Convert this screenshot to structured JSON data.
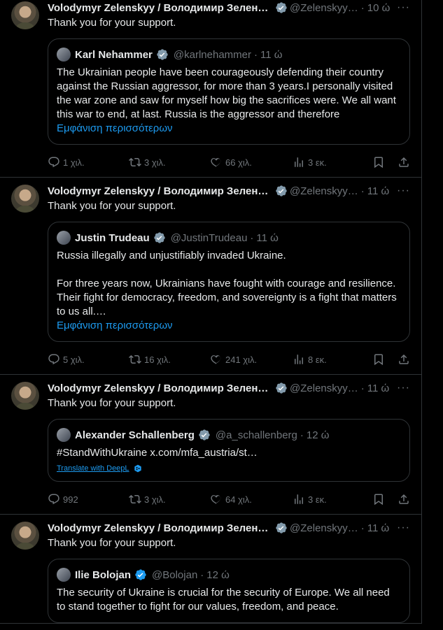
{
  "tweets": [
    {
      "author": "Volodymyr Zelenskyy / Володимир Зеленс…",
      "handle": "@Zelenskyy…",
      "time": "10 ώ",
      "text": "Thank you for your support.",
      "quote": {
        "name": "Karl Nehammer",
        "handle": "@karlnehammer",
        "time": "11 ώ",
        "text": "The Ukrainian people have been courageously defending their country against the Russian aggressor, for more than 3 years.I personally visited the war zone and saw for myself how big the sacrifices were. We all want this war to end, at last. Russia is the aggressor and therefore",
        "show_more": "Εμφάνιση περισσότερων",
        "verified_color": "#829aab"
      },
      "replies": "1 χιλ.",
      "reposts": "3 χιλ.",
      "likes": "66 χιλ.",
      "views": "3 εκ."
    },
    {
      "author": "Volodymyr Zelenskyy / Володимир Зеленсь…",
      "handle": "@Zelenskyy…",
      "time": "11 ώ",
      "text": "Thank you for your support.",
      "quote": {
        "name": "Justin Trudeau",
        "handle": "@JustinTrudeau",
        "time": "11 ώ",
        "text": "Russia illegally and unjustifiably invaded Ukraine.\n\nFor three years now, Ukrainians have fought with courage and resilience. Their fight for democracy, freedom, and sovereignty is a fight that matters to us all.…",
        "show_more": "Εμφάνιση περισσότερων",
        "verified_color": "#829aab"
      },
      "replies": "5 χιλ.",
      "reposts": "16 χιλ.",
      "likes": "241 χιλ.",
      "views": "8 εκ."
    },
    {
      "author": "Volodymyr Zelenskyy / Володимир Зеленсь…",
      "handle": "@Zelenskyy…",
      "time": "11 ώ",
      "text": "Thank you for your support.",
      "quote": {
        "name": "Alexander Schallenberg",
        "handle": "@a_schallenberg",
        "time": "12 ώ",
        "text": "#StandWithUkraine x.com/mfa_austria/st…",
        "translate": "Translate with DeepL",
        "verified_color": "#829aab"
      },
      "replies": "992",
      "reposts": "3 χιλ.",
      "likes": "64 χιλ.",
      "views": "3 εκ."
    },
    {
      "author": "Volodymyr Zelenskyy / Володимир Зеленсь…",
      "handle": "@Zelenskyy…",
      "time": "11 ώ",
      "text": "Thank you for your support.",
      "quote": {
        "name": "Ilie Bolojan",
        "handle": "@Bolojan",
        "time": "12 ώ",
        "text": "The security of Ukraine is crucial for the security of Europe. We all need to stand together to fight for our values, freedom, and peace.",
        "verified_color": "#1d9bf0"
      }
    }
  ],
  "colors": {
    "accent": "#1d9bf0",
    "muted": "#71767b",
    "border": "#2f3336"
  },
  "icons": [
    "more-icon",
    "verified-icon",
    "reply-icon",
    "repost-icon",
    "like-icon",
    "views-icon",
    "bookmark-icon",
    "share-icon",
    "deepl-icon"
  ]
}
